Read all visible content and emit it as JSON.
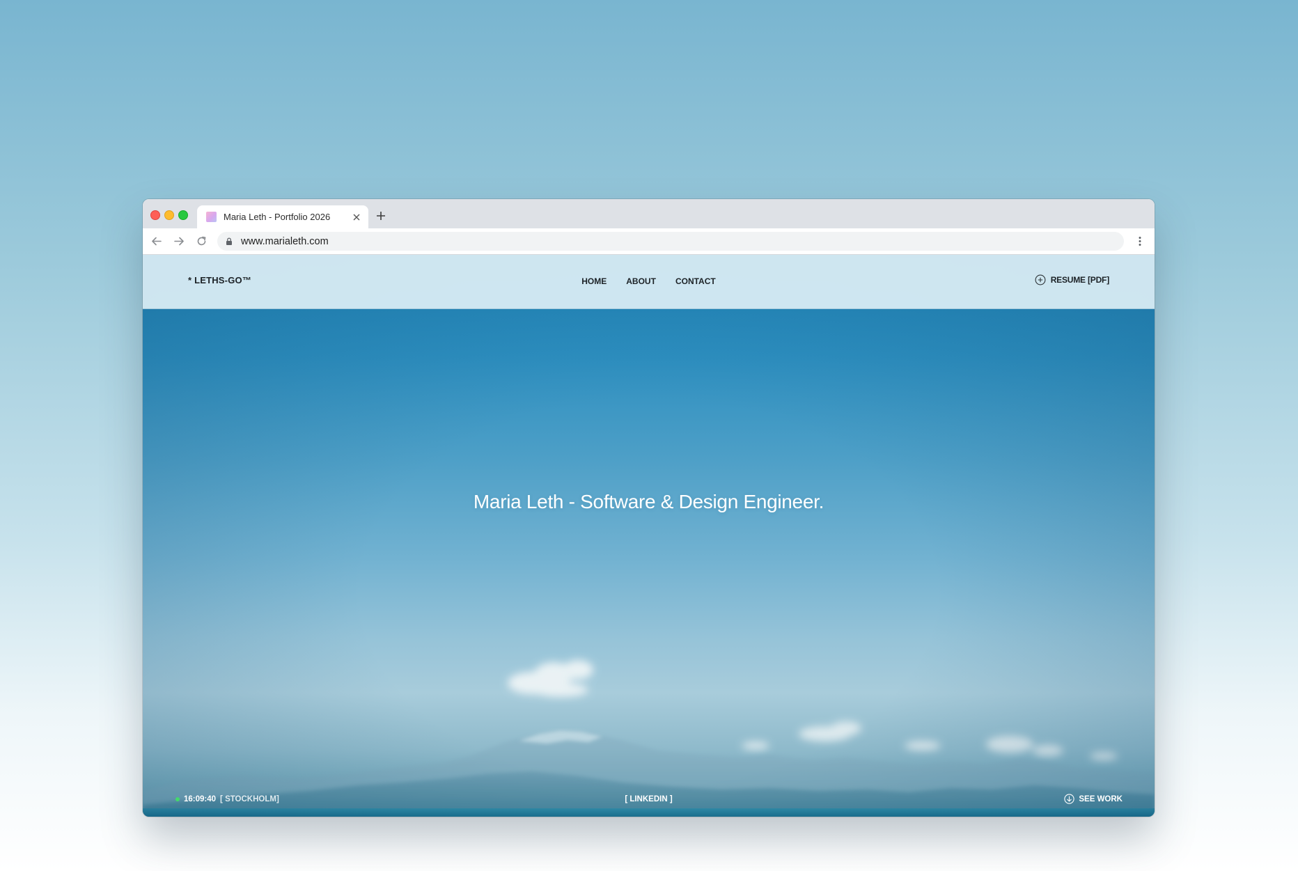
{
  "browser": {
    "tab_title": "Maria Leth - Portfolio 2026",
    "url": "www.marialeth.com",
    "icons": {
      "tab_close": "close-icon",
      "new_tab": "plus-icon",
      "back": "arrow-left-icon",
      "forward": "arrow-right-icon",
      "reload": "reload-icon",
      "lock": "lock-icon",
      "menu": "more-vert-icon"
    }
  },
  "site": {
    "logo": "* LETHS-GO™",
    "nav": {
      "home": "HOME",
      "about": "ABOUT",
      "contact": "CONTACT"
    },
    "resume": "RESUME [PDF]",
    "hero_title": "Maria Leth - Software & Design Engineer.",
    "footer": {
      "time": "16:09:40",
      "location": "[ STOCKHOLM]",
      "linkedin": "[ LINKEDIN ]",
      "see_work": "SEE WORK"
    }
  },
  "colors": {
    "status_dot": "#43d96b",
    "sky_top": "#1f83b6",
    "sky_horizon": "#a8ccdb",
    "header_bg": "#dceef5"
  }
}
